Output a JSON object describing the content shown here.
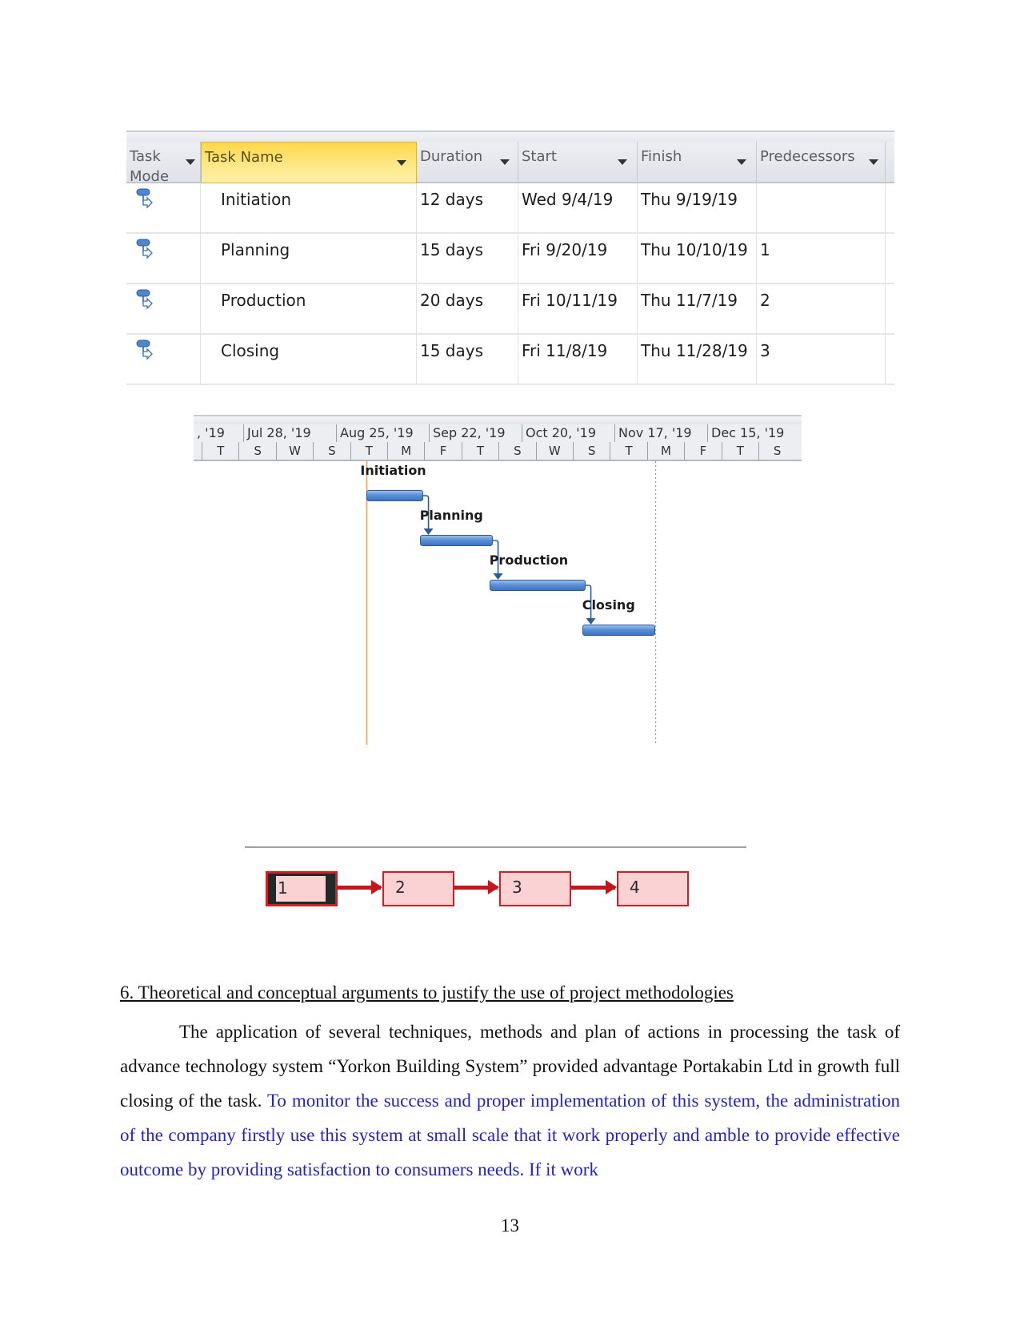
{
  "project_table": {
    "columns": [
      {
        "key": "mode",
        "label": "Task Mode"
      },
      {
        "key": "name",
        "label": "Task Name"
      },
      {
        "key": "duration",
        "label": "Duration"
      },
      {
        "key": "start",
        "label": "Start"
      },
      {
        "key": "finish",
        "label": "Finish"
      },
      {
        "key": "predecessors",
        "label": "Predecessors"
      }
    ],
    "rows": [
      {
        "mode_icon": "auto-scheduled-task-icon",
        "name": "Initiation",
        "duration": "12 days",
        "start": "Wed 9/4/19",
        "finish": "Thu 9/19/19",
        "predecessors": ""
      },
      {
        "mode_icon": "auto-scheduled-task-icon",
        "name": "Planning",
        "duration": "15 days",
        "start": "Fri 9/20/19",
        "finish": "Thu 10/10/19",
        "predecessors": "1"
      },
      {
        "mode_icon": "auto-scheduled-task-icon",
        "name": "Production",
        "duration": "20 days",
        "start": "Fri 10/11/19",
        "finish": "Thu 11/7/19",
        "predecessors": "2"
      },
      {
        "mode_icon": "auto-scheduled-task-icon",
        "name": "Closing",
        "duration": "15 days",
        "start": "Fri 11/8/19",
        "finish": "Thu 11/28/19",
        "predecessors": "3"
      }
    ]
  },
  "gantt": {
    "timescale_top": [
      ", '19",
      "Jul 28, '19",
      "Aug 25, '19",
      "Sep 22, '19",
      "Oct 20, '19",
      "Nov 17, '19",
      "Dec 15, '19"
    ],
    "timescale_bottom": [
      "T",
      "S",
      "W",
      "S",
      "T",
      "M",
      "F",
      "T",
      "S",
      "W",
      "S",
      "T",
      "M",
      "F",
      "T",
      "S"
    ],
    "tasks": [
      {
        "label": "Initiation",
        "start": "2019-09-04",
        "finish": "2019-09-19"
      },
      {
        "label": "Planning",
        "start": "2019-09-20",
        "finish": "2019-10-10"
      },
      {
        "label": "Production",
        "start": "2019-10-11",
        "finish": "2019-11-07"
      },
      {
        "label": "Closing",
        "start": "2019-11-08",
        "finish": "2019-11-28"
      }
    ],
    "colors": {
      "bar": "#4f86cf",
      "today_line": "#f0a060",
      "link": "#2d5a9a"
    }
  },
  "network": {
    "nodes": [
      "1",
      "2",
      "3",
      "4"
    ],
    "colors": {
      "border": "#d21d22",
      "fill": "#fbd2d4",
      "arrow": "#c8151b"
    }
  },
  "section": {
    "heading": "6. Theoretical and conceptual arguments to justify the use of project methodologies",
    "para_black": "The application of several techniques, methods and plan of actions in processing the task of advance technology system “Yorkon Building System” provided advantage Portakabin Ltd in growth full closing of the task.",
    "para_blue": "To monitor the success and proper implementation of this system, the administration of the company firstly use this system at small scale that it work properly and amble to provide effective outcome by providing satisfaction to consumers needs. If it work"
  },
  "page_number": "13"
}
